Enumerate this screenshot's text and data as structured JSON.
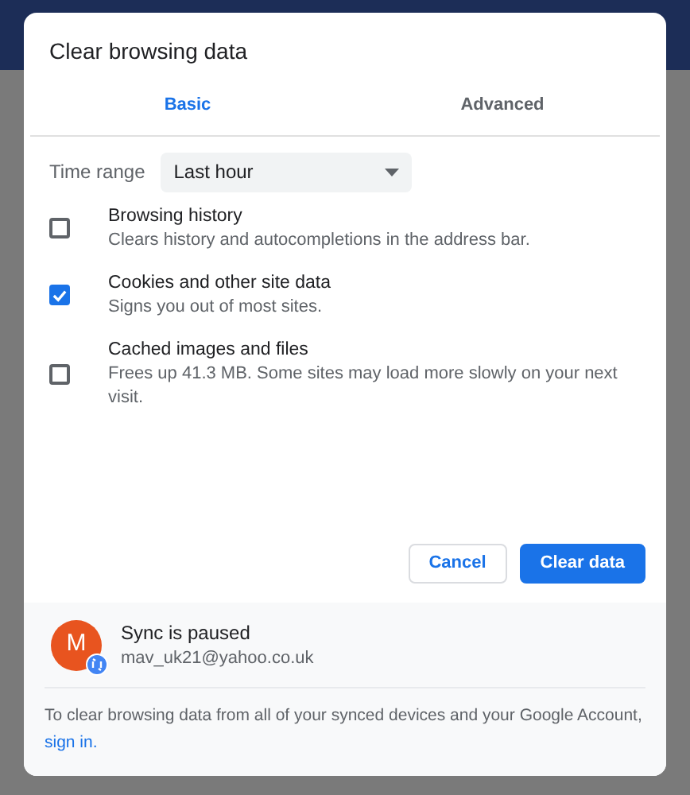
{
  "dialog": {
    "title": "Clear browsing data"
  },
  "tabs": [
    {
      "label": "Basic",
      "selected": true
    },
    {
      "label": "Advanced",
      "selected": false
    }
  ],
  "time_range": {
    "label": "Time range",
    "value": "Last hour"
  },
  "options": [
    {
      "title": "Browsing history",
      "description": "Clears history and autocompletions in the address bar.",
      "checked": false
    },
    {
      "title": "Cookies and other site data",
      "description": "Signs you out of most sites.",
      "checked": true
    },
    {
      "title": "Cached images and files",
      "description": "Frees up 41.3 MB. Some sites may load more slowly on your next visit.",
      "checked": false
    }
  ],
  "buttons": [
    {
      "label": "Cancel",
      "kind": "secondary"
    },
    {
      "label": "Clear data",
      "kind": "primary"
    }
  ],
  "account": {
    "avatar_letter": "M",
    "status": "Sync is paused",
    "email": "mav_uk21@yahoo.co.uk"
  },
  "footer": {
    "text": "To clear browsing data from all of your synced devices and your Google Account,",
    "link": "sign in."
  }
}
